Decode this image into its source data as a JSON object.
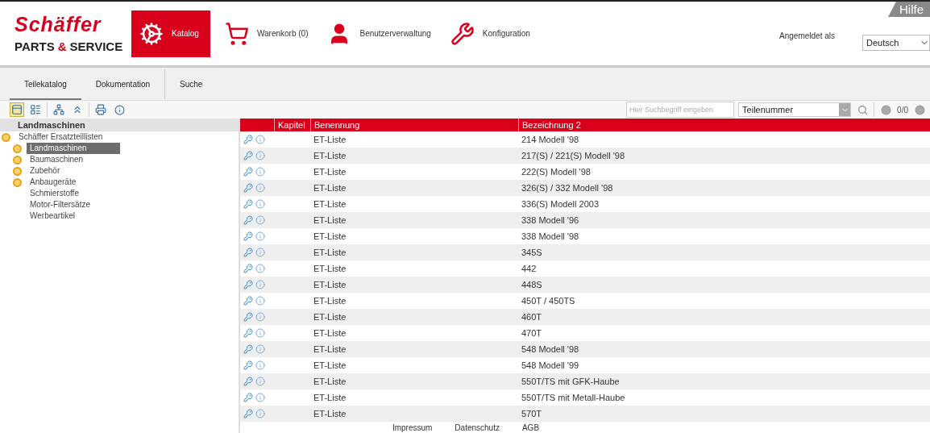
{
  "logo": {
    "brand": "Schäffer",
    "line_start": "PARTS",
    "line_amp": "&",
    "line_end": "SERVICE"
  },
  "nav": [
    {
      "label": "Katalog",
      "kind": "catalog",
      "selected": true
    },
    {
      "label": "Warenkorb (0)",
      "kind": "cart",
      "selected": false
    },
    {
      "label": "Benutzerverwaltung",
      "kind": "user",
      "selected": false
    },
    {
      "label": "Konfiguration",
      "kind": "tools",
      "selected": false
    }
  ],
  "account": {
    "label": "Angemeldet als",
    "language": "Deutsch",
    "help": "Hilfe"
  },
  "tabs": [
    {
      "label": "Teilekatalog",
      "selected": true
    },
    {
      "label": "Dokumentation",
      "selected": false
    },
    {
      "label": "Suche",
      "selected": false
    }
  ],
  "search": {
    "placeholder": "Hier Suchbegriff eingeben",
    "field": "Teilenummer",
    "counter": "0/0"
  },
  "tree": {
    "title": "Landmaschinen",
    "root": {
      "label": "Schäffer Ersatzteillisten",
      "expanded": true,
      "children": [
        {
          "label": "Landmaschinen",
          "kind": "folder",
          "selected": true
        },
        {
          "label": "Baumaschinen",
          "kind": "folder",
          "selected": false
        },
        {
          "label": "Zubehör",
          "kind": "folder",
          "selected": false
        },
        {
          "label": "Anbaugeräte",
          "kind": "folder",
          "selected": false
        },
        {
          "label": "Schmierstoffe",
          "kind": "leaf",
          "selected": false
        },
        {
          "label": "Motor-Filtersätze",
          "kind": "leaf",
          "selected": false
        },
        {
          "label": "Werbeartikel",
          "kind": "leaf",
          "selected": false
        }
      ]
    }
  },
  "table": {
    "columns": [
      "Kapitel",
      "Benennung",
      "Bezeichnung 2"
    ],
    "rows": [
      [
        "",
        "ET-Liste",
        "214 Modell '98"
      ],
      [
        "",
        "ET-Liste",
        "217(S) / 221(S) Modell '98"
      ],
      [
        "",
        "ET-Liste",
        "222(S) Modell '98"
      ],
      [
        "",
        "ET-Liste",
        "326(S) / 332 Modell '98"
      ],
      [
        "",
        "ET-Liste",
        "336(S) Modell 2003"
      ],
      [
        "",
        "ET-Liste",
        "338 Modell '96"
      ],
      [
        "",
        "ET-Liste",
        "338 Modell '98"
      ],
      [
        "",
        "ET-Liste",
        "345S"
      ],
      [
        "",
        "ET-Liste",
        "442"
      ],
      [
        "",
        "ET-Liste",
        "448S"
      ],
      [
        "",
        "ET-Liste",
        "450T / 450TS"
      ],
      [
        "",
        "ET-Liste",
        "460T"
      ],
      [
        "",
        "ET-Liste",
        "470T"
      ],
      [
        "",
        "ET-Liste",
        "548 Modell '98"
      ],
      [
        "",
        "ET-Liste",
        "548 Modell '99"
      ],
      [
        "",
        "ET-Liste",
        "550T/TS mit GFK-Haube"
      ],
      [
        "",
        "ET-Liste",
        "550T/TS mit Metall-Haube"
      ],
      [
        "",
        "ET-Liste",
        "570T"
      ]
    ]
  },
  "footer": [
    "Impressum",
    "Datenschutz",
    "AGB"
  ]
}
